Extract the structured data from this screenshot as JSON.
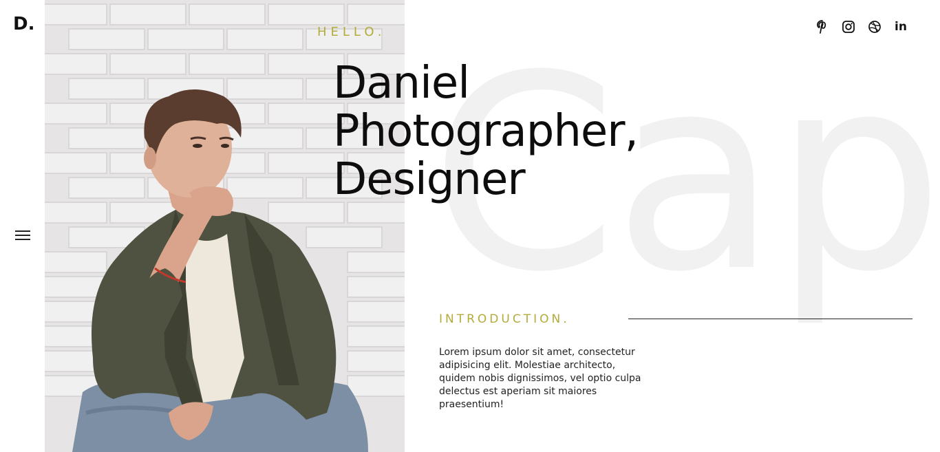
{
  "brand": {
    "logo_text": "D."
  },
  "hero": {
    "greeting": "HELLO.",
    "headline_lines": [
      "Daniel",
      "Photographer,",
      "Designer"
    ],
    "watermark": "Captu"
  },
  "social": {
    "icons": [
      "pinterest-icon",
      "instagram-icon",
      "dribbble-icon",
      "linkedin-icon"
    ],
    "linkedin_label": "in"
  },
  "intro": {
    "heading": "INTRODUCTION.",
    "body": "Lorem ipsum dolor sit amet, consectetur adipisicing elit. Molestiae architecto, quidem nobis dignissimos, vel optio culpa delectus est aperiam sit maiores praesentium!"
  },
  "colors": {
    "accent": "#b3ab3a",
    "text": "#0d0d0d",
    "watermark": "#f1f1f1",
    "background": "#ffffff"
  }
}
